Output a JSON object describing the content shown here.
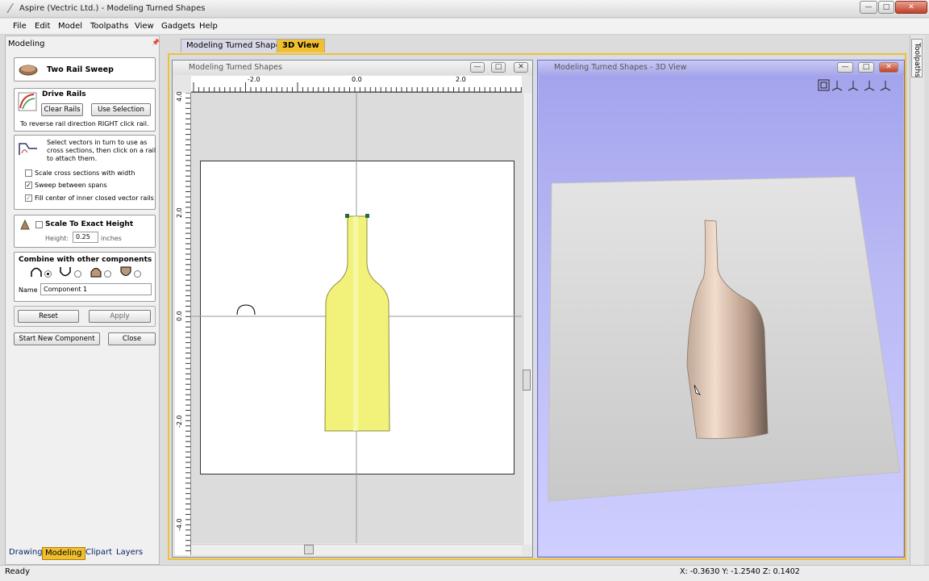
{
  "window": {
    "title": "Aspire (Vectric Ltd.) - Modeling Turned Shapes"
  },
  "menu": [
    "File",
    "Edit",
    "Model",
    "Toolpaths",
    "View",
    "Gadgets",
    "Help"
  ],
  "left_panel": {
    "title": "Modeling",
    "header": "Two Rail Sweep",
    "drive_rails": {
      "title": "Drive Rails",
      "clear_btn": "Clear Rails",
      "use_selection_btn": "Use Selection",
      "hint": "To reverse rail direction RIGHT click rail."
    },
    "cross_sections": {
      "instruction_l1": "Select vectors in turn to use as",
      "instruction_l2": "cross sections, then click on a rail",
      "instruction_l3": "to attach them.",
      "options": [
        {
          "label": "Scale cross sections with width",
          "checked": false
        },
        {
          "label": "Sweep between spans",
          "checked": true
        },
        {
          "label": "Fill center of inner closed vector rails",
          "checked": true
        }
      ]
    },
    "scale": {
      "label": "Scale To Exact Height",
      "height_label": "Height:",
      "height_value": "0.25",
      "unit": "inches"
    },
    "combine": {
      "title": "Combine with other components",
      "name_label": "Name",
      "name_value": "Component 1"
    },
    "reset_btn": "Reset",
    "apply_btn": "Apply",
    "start_new_btn": "Start New Component",
    "close_btn": "Close",
    "bottom_tabs": [
      "Drawing",
      "Modeling",
      "Clipart",
      "Layers"
    ]
  },
  "doc_tabs": [
    "Modeling Turned Shapes",
    "3D View"
  ],
  "view2d": {
    "title": "Modeling Turned Shapes",
    "h_ticks": [
      "-2.0",
      "0.0",
      "2.0"
    ],
    "v_ticks": [
      "4.0",
      "2.0",
      "0.0",
      "-2.0",
      "-4.0"
    ]
  },
  "view3d": {
    "title": "Modeling Turned Shapes - 3D View"
  },
  "right_tab": "Toolpaths",
  "status": {
    "text": "Ready",
    "coords": "X: -0.3630 Y: -1.2540 Z: 0.1402"
  },
  "colors": {
    "accent_tab": "#f0c030",
    "bottle_fill": "#f2f27a",
    "bottle_3d": "#e6c8b8"
  }
}
